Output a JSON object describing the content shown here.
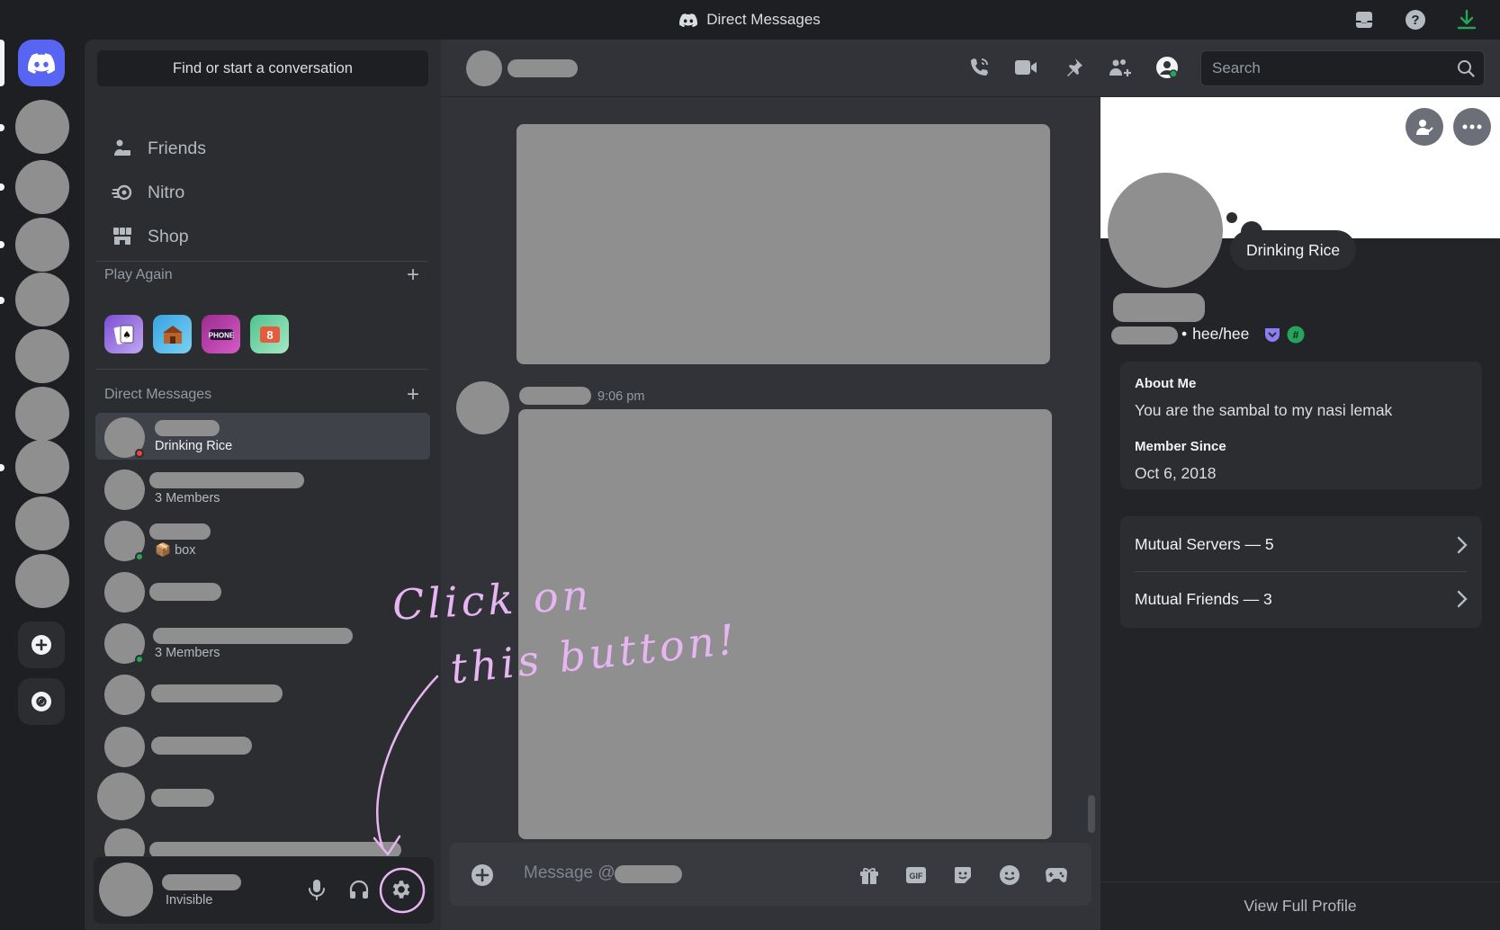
{
  "titlebar": {
    "title": "Direct Messages",
    "icons": [
      "discord-logo-icon",
      "inbox-icon",
      "help-icon",
      "download-icon"
    ]
  },
  "sidebar": {
    "find_button": "Find or start a conversation",
    "nav": [
      {
        "label": "Friends",
        "icon": "friends-icon"
      },
      {
        "label": "Nitro",
        "icon": "nitro-icon"
      },
      {
        "label": "Shop",
        "icon": "shop-icon"
      }
    ],
    "play_again": {
      "heading": "Play Again",
      "add": "+"
    },
    "games": [
      "card-game-icon",
      "farm-game-icon",
      "phone-game-icon",
      "number-game-icon"
    ],
    "direct_messages": {
      "heading": "Direct Messages",
      "add": "+"
    },
    "dms": [
      {
        "subtitle": "Drinking Rice",
        "status": "#f23f43",
        "active": true
      },
      {
        "subtitle": "3 Members"
      },
      {
        "subtitle": "📦 box",
        "status": "#23a55a"
      },
      {
        "subtitle": ""
      },
      {
        "subtitle": "3 Members",
        "status": "#23a55a"
      },
      {
        "subtitle": ""
      },
      {
        "subtitle": ""
      },
      {
        "subtitle": ""
      },
      {
        "subtitle": ""
      }
    ]
  },
  "user_panel": {
    "status": "Invisible",
    "buttons": [
      "microphone-icon",
      "headphones-icon",
      "settings-gear-icon"
    ]
  },
  "chat": {
    "header_icons": [
      "voice-call-icon",
      "video-call-icon",
      "pinned-icon",
      "add-friends-icon",
      "user-profile-icon"
    ],
    "search_placeholder": "Search",
    "message_time": "9:06 pm",
    "composer_placeholder": "Message @",
    "composer_icons": [
      "gift-icon",
      "gif-icon",
      "sticker-icon",
      "emoji-icon",
      "activity-icon"
    ]
  },
  "profile": {
    "status_text": "Drinking Rice",
    "pronouns": "hee/hee",
    "about_me_label": "About Me",
    "about_me": "You are the sambal to my nasi lemak",
    "member_since_label": "Member Since",
    "member_since": "Oct 6, 2018",
    "mutual_servers": "Mutual Servers — 5",
    "mutual_friends": "Mutual Friends — 3",
    "view_full": "View Full Profile"
  },
  "annotation": {
    "line1": "Click on",
    "line2": "this button!",
    "color": "#e7b6f2"
  }
}
